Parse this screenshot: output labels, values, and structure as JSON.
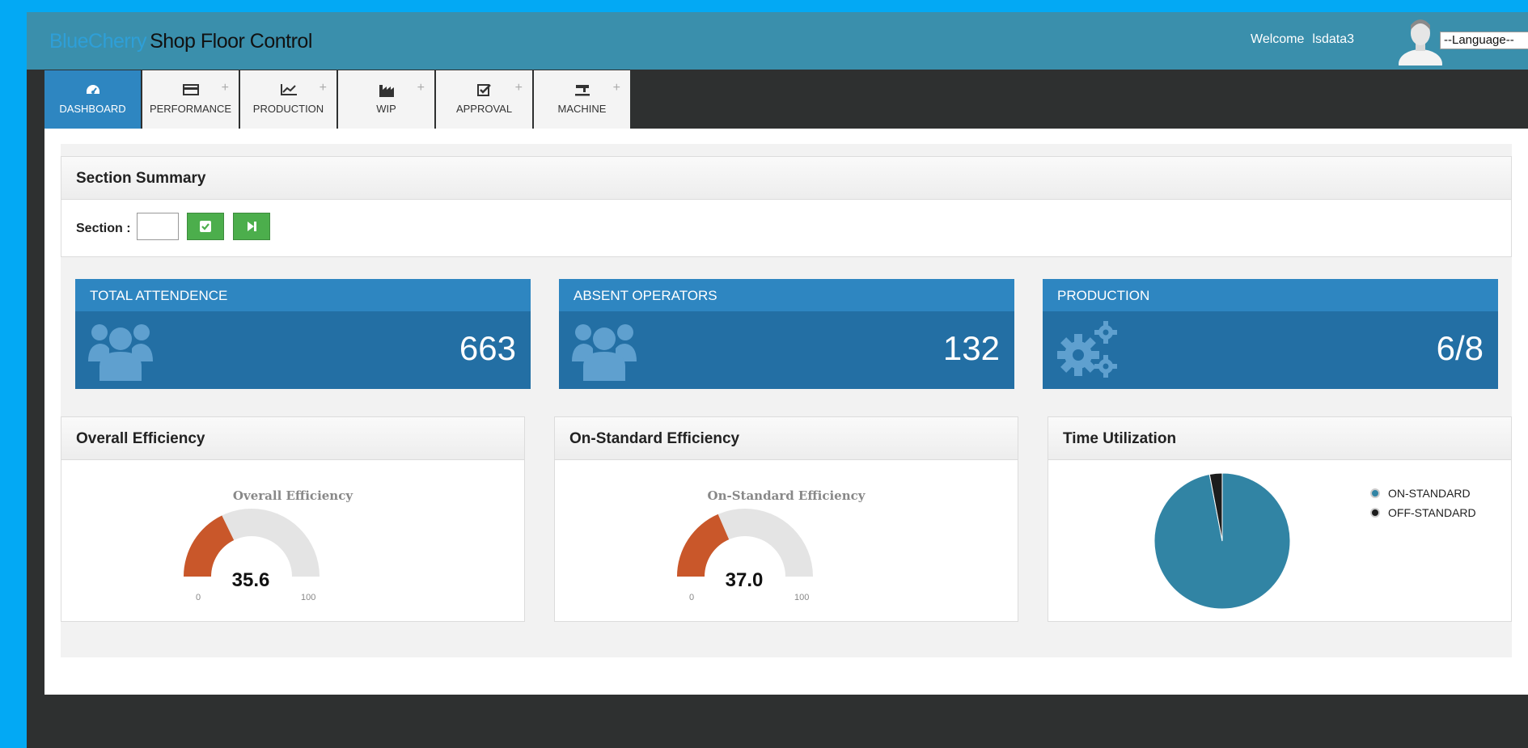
{
  "app": {
    "brand_primary": "BlueCherry",
    "brand_secondary": "Shop Floor Control"
  },
  "header": {
    "welcome": "Welcome",
    "username": "lsdata3",
    "language_select": "--Language--"
  },
  "tabs": [
    {
      "label": "DASHBOARD",
      "icon": "dashboard-icon",
      "active": true
    },
    {
      "label": "PERFORMANCE",
      "icon": "card-icon",
      "plus": "+"
    },
    {
      "label": "PRODUCTION",
      "icon": "line-chart-icon",
      "plus": "+"
    },
    {
      "label": "WIP",
      "icon": "factory-icon",
      "plus": "+"
    },
    {
      "label": "APPROVAL",
      "icon": "check-square-icon",
      "plus": "+"
    },
    {
      "label": "MACHINE",
      "icon": "sewing-machine-icon",
      "plus": "+"
    }
  ],
  "section_summary": {
    "title": "Section Summary",
    "section_label": "Section :",
    "section_value": ""
  },
  "stats": [
    {
      "title": "TOTAL ATTENDENCE",
      "value": "663",
      "icon": "users-icon"
    },
    {
      "title": "ABSENT OPERATORS",
      "value": "132",
      "icon": "users-icon"
    },
    {
      "title": "PRODUCTION",
      "value": "6/8",
      "icon": "gears-icon"
    }
  ],
  "panels": {
    "overall": {
      "title": "Overall Efficiency"
    },
    "onstandard": {
      "title": "On-Standard Efficiency"
    },
    "time": {
      "title": "Time Utilization"
    }
  },
  "colors": {
    "gauge_fill": "#c9572a",
    "gauge_track": "#e4e4e4",
    "pie_on": "#3184a4",
    "pie_off": "#1c1c1c"
  },
  "chart_data": [
    {
      "type": "gauge",
      "title": "Overall Efficiency",
      "value": 35.6,
      "display": "35.6",
      "min": 0,
      "max": 100,
      "min_label": "0",
      "max_label": "100"
    },
    {
      "type": "gauge",
      "title": "On-Standard Efficiency",
      "value": 37.0,
      "display": "37.0",
      "min": 0,
      "max": 100,
      "min_label": "0",
      "max_label": "100"
    },
    {
      "type": "pie",
      "categories": [
        "ON-STANDARD",
        "OFF-STANDARD"
      ],
      "values": [
        97,
        3
      ],
      "legend_position": "top-right"
    }
  ]
}
